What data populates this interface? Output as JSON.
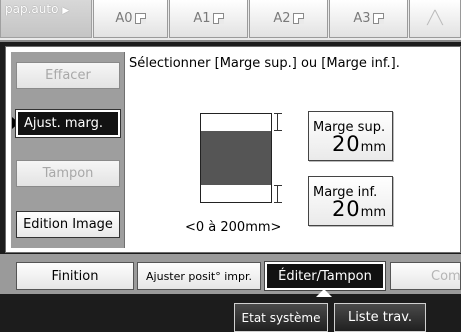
{
  "paper_bar": {
    "auto_label": "pap.auto",
    "sizes": [
      "A0",
      "A1",
      "A2",
      "A3"
    ]
  },
  "sidebar": {
    "effacer": "Effacer",
    "ajust_marg": "Ajust. marg.",
    "tampon": "Tampon",
    "edition_image": "Edition Image"
  },
  "main": {
    "instruction": "Sélectionner [Marge sup.] ou [Marge inf.].",
    "range": "<0 à 200mm>",
    "marge_sup": {
      "label": "Marge sup.",
      "value": "20",
      "unit": "mm"
    },
    "marge_inf": {
      "label": "Marge inf.",
      "value": "20",
      "unit": "mm"
    }
  },
  "tabs": {
    "finition": "Finition",
    "ajuster": "Ajuster posit° impr.",
    "editer": "Éditer/Tampon",
    "combi": "Combi"
  },
  "status": {
    "etat": "Etat système",
    "liste": "Liste trav."
  },
  "colors": {
    "selected": "#111111",
    "page_fill": "#555555",
    "disabled_text": "#a8a8a8"
  }
}
